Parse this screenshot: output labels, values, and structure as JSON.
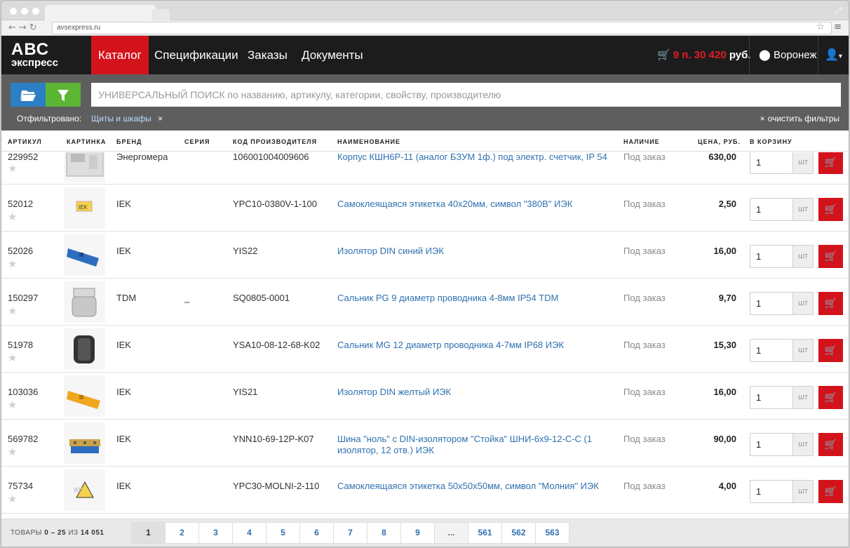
{
  "browser": {
    "url": "avsexpress.ru"
  },
  "logo": {
    "line1": "АВС",
    "line2": "экспресс"
  },
  "nav": {
    "catalog": "Каталог",
    "specs": "Спецификации",
    "orders": "Заказы",
    "documents": "Документы"
  },
  "cart": {
    "items": "9 п.",
    "sum": "30 420",
    "currency": "руб."
  },
  "city": "Воронеж",
  "search": {
    "placeholder": "УНИВЕРСАЛЬНЫЙ ПОИСК по названию, артикулу, категории, свойству, производителю"
  },
  "filters": {
    "label": "Отфильтровано:",
    "tag": "Щиты и шкафы",
    "clear": "очистить фильтры"
  },
  "columns": {
    "article": "АРТИКУЛ",
    "image": "КАРТИНКА",
    "brand": "БРЕНД",
    "series": "СЕРИЯ",
    "code": "КОД ПРОИЗВОДИТЕЛЯ",
    "name": "НАИМЕНОВАНИЕ",
    "avail": "НАЛИЧИЕ",
    "price": "ЦЕНА, РУБ.",
    "cart": "В КОРЗИНУ"
  },
  "rows": [
    {
      "article": "229952",
      "brand": "Энергомера",
      "series": "",
      "code": "106001004009606",
      "name": "Корпус КШН6Р-11 (аналог БЗУМ 1ф.) под электр. счетчик, IP 54",
      "avail": "Под заказ",
      "price": "630,00",
      "qty": "1",
      "unit": "шт"
    },
    {
      "article": "52012",
      "brand": "IEK",
      "series": "",
      "code": "YPC10-0380V-1-100",
      "name": "Самоклеящаяся этикетка 40х20мм, символ \"380В\" ИЭК",
      "avail": "Под заказ",
      "price": "2,50",
      "qty": "1",
      "unit": "шт"
    },
    {
      "article": "52026",
      "brand": "IEK",
      "series": "",
      "code": "YIS22",
      "name": "Изолятор DIN синий ИЭК",
      "avail": "Под заказ",
      "price": "16,00",
      "qty": "1",
      "unit": "шт"
    },
    {
      "article": "150297",
      "brand": "TDM",
      "series": "_",
      "code": "SQ0805-0001",
      "name": "Сальник PG 9 диаметр проводника 4-8мм IP54 TDM",
      "avail": "Под заказ",
      "price": "9,70",
      "qty": "1",
      "unit": "шт"
    },
    {
      "article": "51978",
      "brand": "IEK",
      "series": "",
      "code": "YSA10-08-12-68-K02",
      "name": "Сальник MG 12 диаметр проводника 4-7мм IP68 ИЭК",
      "avail": "Под заказ",
      "price": "15,30",
      "qty": "1",
      "unit": "шт"
    },
    {
      "article": "103036",
      "brand": "IEK",
      "series": "",
      "code": "YIS21",
      "name": "Изолятор DIN желтый ИЭК",
      "avail": "Под заказ",
      "price": "16,00",
      "qty": "1",
      "unit": "шт"
    },
    {
      "article": "569782",
      "brand": "IEK",
      "series": "",
      "code": "YNN10-69-12P-K07",
      "name": "Шина \"ноль\" с DIN-изолятором \"Стойка\" ШНИ-6х9-12-С-С (1 изолятор, 12 отв.) ИЭК",
      "avail": "Под заказ",
      "price": "90,00",
      "qty": "1",
      "unit": "шт"
    },
    {
      "article": "75734",
      "brand": "IEK",
      "series": "",
      "code": "YPC30-MOLNI-2-110",
      "name": "Самоклеящаяся этикетка 50х50х50мм, символ \"Молния\" ИЭК",
      "avail": "Под заказ",
      "price": "4,00",
      "qty": "1",
      "unit": "шт"
    }
  ],
  "footer": {
    "label": "ТОВАРЫ",
    "range": "0 – 25",
    "of": "ИЗ",
    "total": "14 051",
    "pages": [
      "1",
      "2",
      "3",
      "4",
      "5",
      "6",
      "7",
      "8",
      "9",
      "...",
      "561",
      "562",
      "563"
    ]
  },
  "colors": {
    "accent": "#d3131b",
    "blue": "#2c7fc4",
    "green": "#5db534",
    "link": "#2f71b0"
  }
}
